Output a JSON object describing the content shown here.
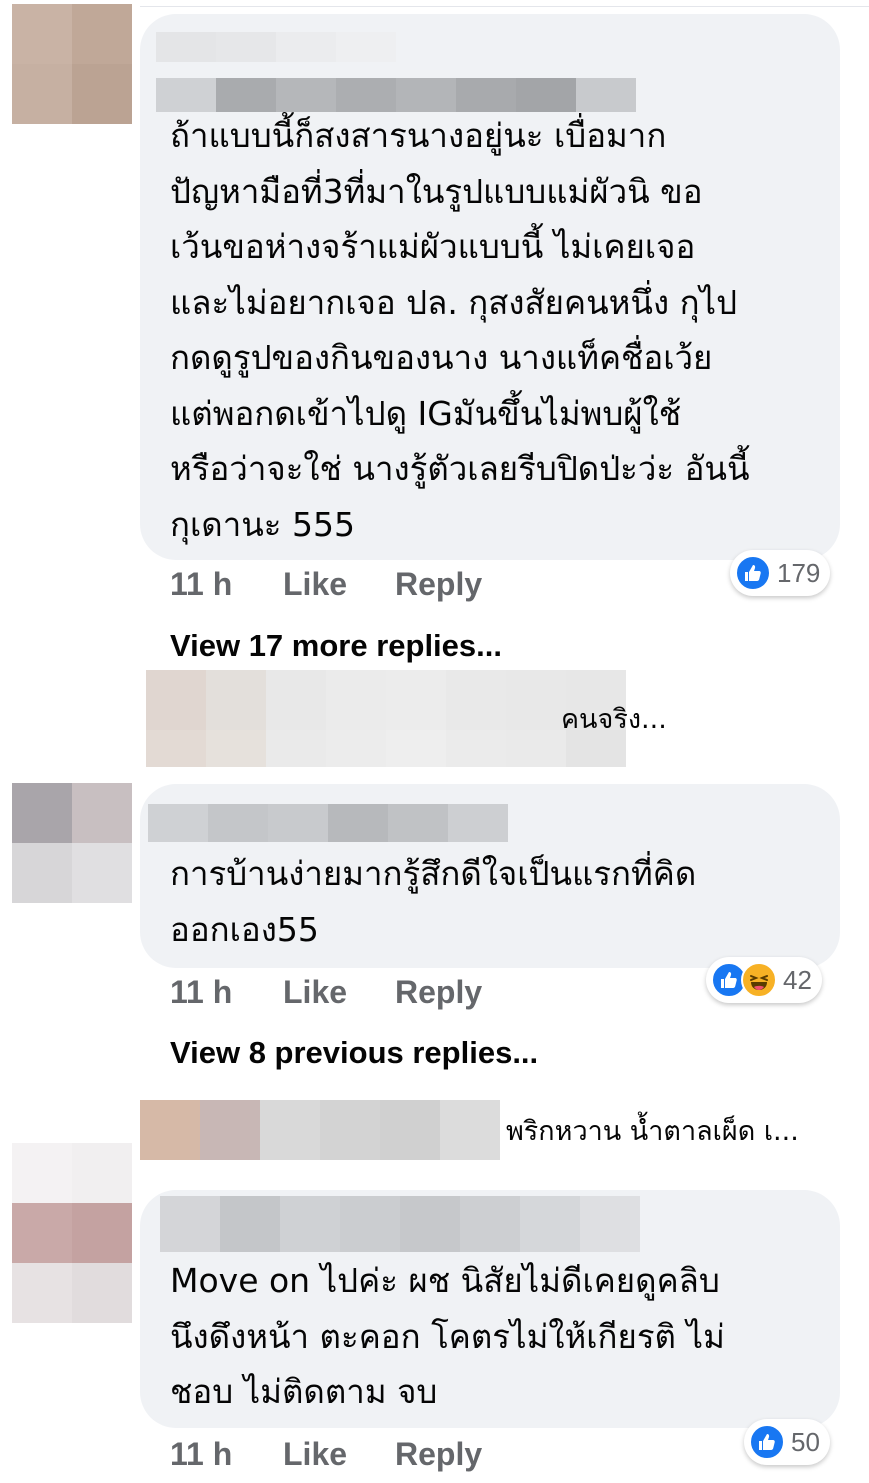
{
  "comments": [
    {
      "text": "ถ้าแบบนี้ก็สงสารนางอยู่นะ เบื่อมาก\nปัญหามือที่3ที่มาในรูปแบบแม่ผัวนิ ขอ\nเว้นขอห่างจร้าแม่ผัวแบบนี้ ไม่เคยเจอ\nและไม่อยากเจอ ปล. กุสงสัยคนหนึ่ง กุไป\nกดดูรูปของกินของนาง นางแท็คชื่อเว้ย\nแต่พอกดเข้าไปดู IGมันขึ้นไม่พบผู้ใช้\nหรือว่าจะใช่ นางรู้ตัวเลยรีบปิดป่ะว่ะ อันนี้\nกุเดานะ 555",
      "time": "11 h",
      "like_label": "Like",
      "reply_label": "Reply",
      "reaction_count": "179",
      "reactions": [
        "like-icon"
      ]
    },
    {
      "text": "การบ้านง่ายมากรู้สึกดีใจเป็นแรกที่คิด\nออกเอง55",
      "time": "11 h",
      "like_label": "Like",
      "reply_label": "Reply",
      "reaction_count": "42",
      "reactions": [
        "like-icon",
        "haha-icon"
      ]
    },
    {
      "text": "Move on ไปค่ะ ผช นิสัยไม่ดีเคยดูคลิบ\nนึงดึงหน้า ตะคอก โคตรไม่ให้เกียรติ ไม่\nชอบ ไม่ติดตาม จบ",
      "time": "11 h",
      "like_label": "Like",
      "reply_label": "Reply",
      "reaction_count": "50",
      "reactions": [
        "like-icon"
      ]
    }
  ],
  "thread_links": {
    "view_more": "View 17 more replies...",
    "view_previous": "View 8 previous replies..."
  },
  "reply_previews": [
    {
      "text": "คนจริง..."
    },
    {
      "text": "พริกหวาน น้ำตาลเผ็ด เ..."
    }
  ],
  "colors": {
    "bubble": "#f0f2f5",
    "meta": "#65676b",
    "like": "#1877f2",
    "haha": "#f7b125"
  }
}
